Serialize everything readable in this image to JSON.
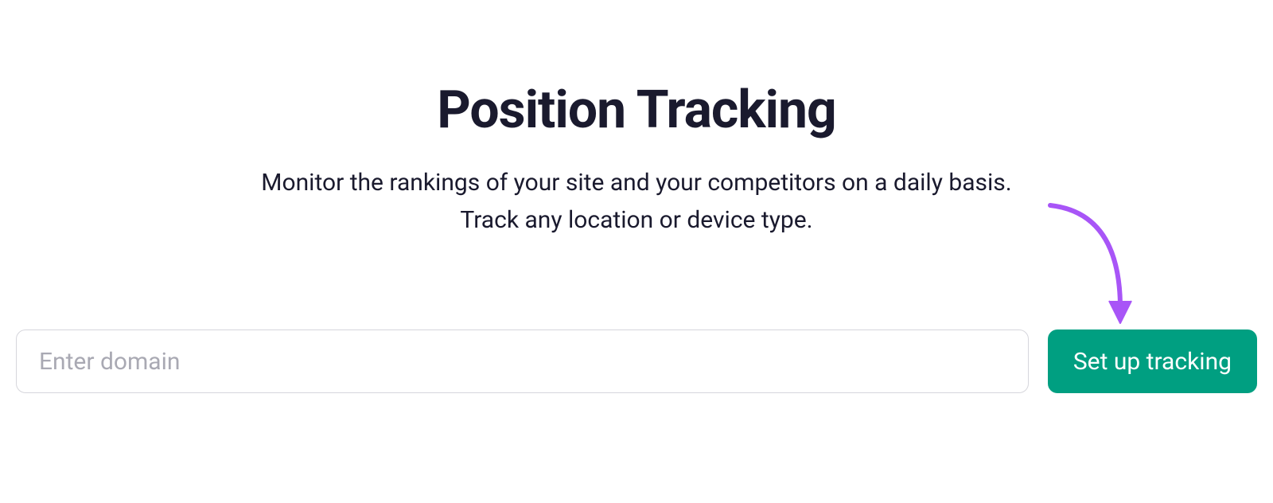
{
  "header": {
    "title": "Position Tracking",
    "subtitle_line1": "Monitor the rankings of your site and your competitors on a daily basis.",
    "subtitle_line2": "Track any location or device type."
  },
  "form": {
    "domain_placeholder": "Enter domain",
    "domain_value": "",
    "submit_label": "Set up tracking"
  },
  "annotation": {
    "arrow_color": "#A855F7"
  }
}
